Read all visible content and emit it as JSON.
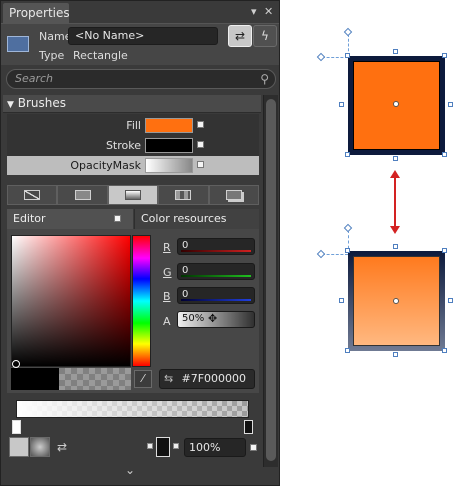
{
  "panel": {
    "title": "Properties",
    "window_controls": [
      "pin-icon",
      "close-icon"
    ],
    "object": {
      "name_label": "Name",
      "name_value": "<No Name>",
      "type_label": "Type",
      "type_value": "Rectangle"
    },
    "search_placeholder": "Search",
    "section_title": "Brushes",
    "brushes": [
      {
        "label": "Fill",
        "color": "#ff7010",
        "selected": false
      },
      {
        "label": "Stroke",
        "color": "#000000",
        "selected": false
      },
      {
        "label": "OpacityMask",
        "color": "gradient",
        "selected": true
      }
    ],
    "brush_type_tabs": [
      "no-brush-icon",
      "solid-brush-icon",
      "gradient-brush-icon",
      "tile-brush-icon",
      "brush-resource-icon"
    ],
    "active_brush_tab": 2,
    "editor_tab": "Editor",
    "color_resources_tab": "Color resources",
    "channels": [
      {
        "label": "R",
        "value": "0",
        "line_color": "#d02020"
      },
      {
        "label": "G",
        "value": "0",
        "line_color": "#20c020"
      },
      {
        "label": "B",
        "value": "0",
        "line_color": "#2040e0"
      },
      {
        "label": "A",
        "value": "50%"
      }
    ],
    "hex_value": "#7F000000",
    "gradient_stop_offset": "100%"
  },
  "canvas": {
    "top_fill": "#ff7010",
    "bottom_fill_top": "#ff7a1e",
    "bottom_fill_bottom": "#ffb880",
    "stroke": "#0d1a3c",
    "arrow_color": "#d32222"
  }
}
